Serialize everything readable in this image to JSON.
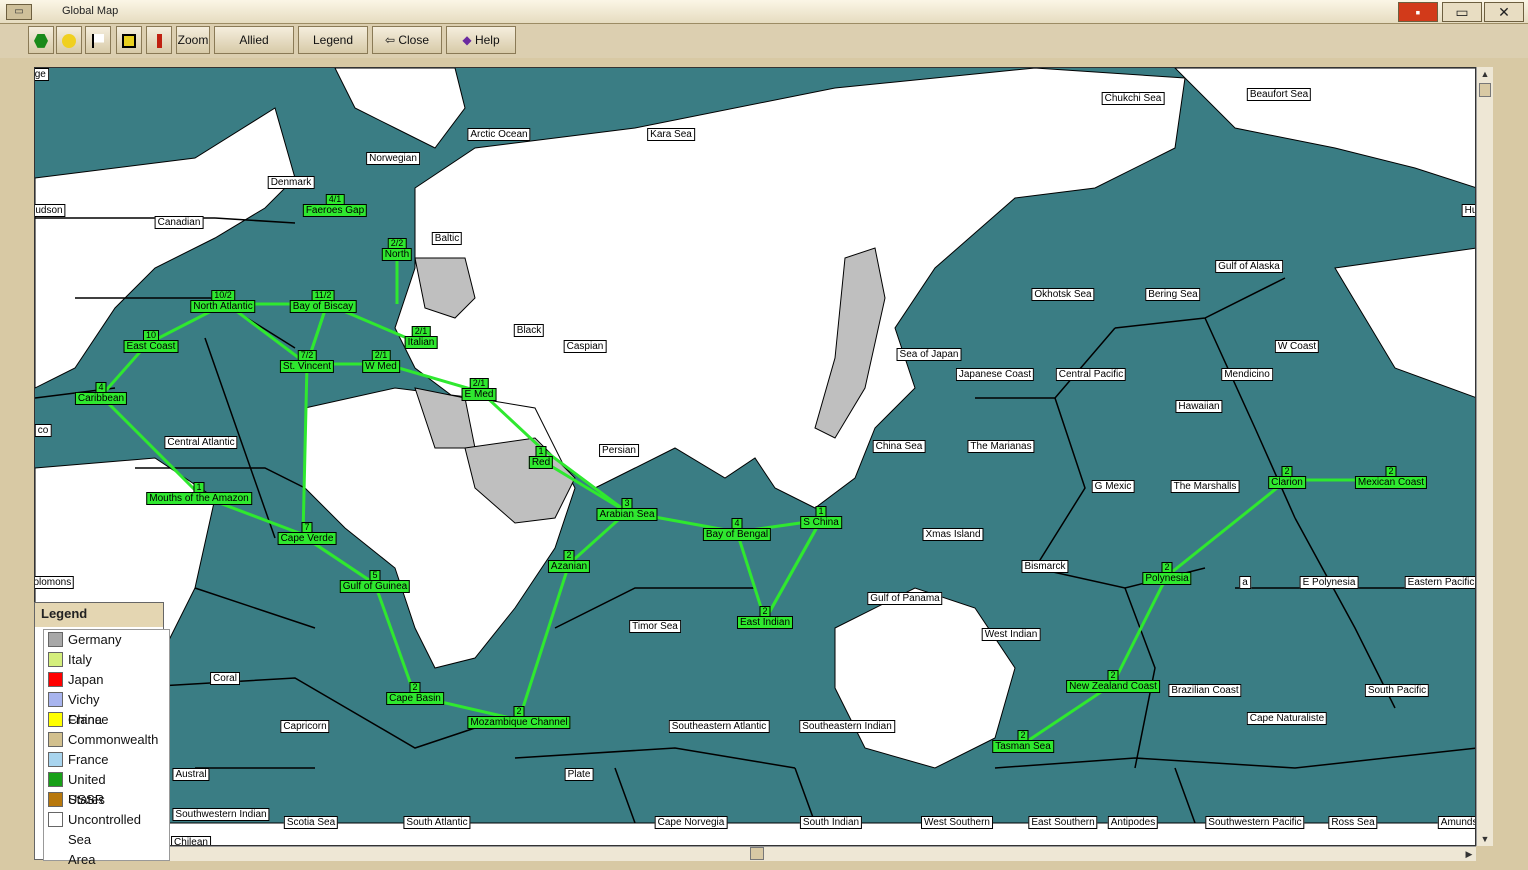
{
  "window": {
    "title": "Global Map",
    "icon": "map-window-icon"
  },
  "toolbar": {
    "icons": [
      "hexagon-icon",
      "sun-icon",
      "flag-icon",
      "grid-icon",
      "marker-icon"
    ],
    "zoom_label": "Zoom",
    "convoys_label": "Allied Convoys",
    "legend_label": "Legend",
    "close_label": "Close",
    "help_label": "Help"
  },
  "map": {
    "colors": {
      "sea": "#3a7d84",
      "land": "#ffffff",
      "convoy_route": "#2fe82f",
      "axis_land": "#bfbfbf"
    },
    "sea_areas": [
      "Chukchi Sea",
      "Beaufort Sea",
      "Arctic Ocean",
      "Kara Sea",
      "Norwegian",
      "Denmark",
      "udson",
      "Canadian",
      "Baltic",
      "Okhotsk Sea",
      "Bering Sea",
      "Gulf of Alaska",
      "Hu",
      "Black",
      "Caspian",
      "Sea of Japan",
      "Japanese Coast",
      "Central Pacific",
      "Mendicino",
      "W Coast",
      "co",
      "Central Atlantic",
      "Hawaiian",
      "Persian",
      "China Sea",
      "The Marianas",
      "G Mexic",
      "The Marshalls",
      "Xmas Island",
      "Bismarck",
      "The Solomons",
      "a",
      "E Polynesia",
      "Eastern Pacific",
      "Gulf of Panama",
      "Timor Sea",
      "West Indian",
      "Coral",
      "Brazilian Coast",
      "South Pacific",
      "Capricorn",
      "Southeastern Atlantic",
      "Southeastern Indian",
      "Cape Naturaliste",
      "Austral",
      "Plate",
      "Southwestern Indian",
      "Scotia Sea",
      "South Atlantic",
      "Cape Norvegia",
      "South Indian",
      "West Southern",
      "East Southern",
      "Antipodes",
      "Southwestern Pacific",
      "Ross Sea",
      "Amundsen Sea",
      "Chilean",
      "sage"
    ],
    "convoy_areas": [
      {
        "name": "Faeroes Gap",
        "count": "4/1"
      },
      {
        "name": "North",
        "count": "2/2"
      },
      {
        "name": "North Atlantic",
        "count": "10/2"
      },
      {
        "name": "Bay of Biscay",
        "count": "11/2"
      },
      {
        "name": "East Coast",
        "count": "10"
      },
      {
        "name": "Italian",
        "count": "2/1"
      },
      {
        "name": "St. Vincent",
        "count": "7/2"
      },
      {
        "name": "W Med",
        "count": "2/1"
      },
      {
        "name": "Caribbean",
        "count": "4"
      },
      {
        "name": "E Med",
        "count": "2/1"
      },
      {
        "name": "Red",
        "count": "1"
      },
      {
        "name": "Mouths of the Amazon",
        "count": "1"
      },
      {
        "name": "Arabian Sea",
        "count": "3"
      },
      {
        "name": "Bay of Bengal",
        "count": "4"
      },
      {
        "name": "S China",
        "count": "1"
      },
      {
        "name": "Cape Verde",
        "count": "7"
      },
      {
        "name": "Azanian",
        "count": "2"
      },
      {
        "name": "Gulf of Guinea",
        "count": "5"
      },
      {
        "name": "East Indian",
        "count": "2"
      },
      {
        "name": "Cape Basin",
        "count": "2"
      },
      {
        "name": "Mozambique Channel",
        "count": "2"
      },
      {
        "name": "Clarion",
        "count": "2"
      },
      {
        "name": "Mexican Coast",
        "count": "2"
      },
      {
        "name": "Polynesia",
        "count": "2"
      },
      {
        "name": "New Zealand Coast",
        "count": "2"
      },
      {
        "name": "Tasman Sea",
        "count": "2"
      }
    ]
  },
  "legend": {
    "title": "Legend",
    "items": [
      {
        "label": "Germany",
        "color": "#a8a8a8"
      },
      {
        "label": "Italy",
        "color": "#d4ee7c"
      },
      {
        "label": "Japan",
        "color": "#ff0000"
      },
      {
        "label": "Vichy France",
        "color": "#a8b4ee"
      },
      {
        "label": "China",
        "color": "#ffff00"
      },
      {
        "label": "Commonwealth",
        "color": "#d2c08e"
      },
      {
        "label": "France",
        "color": "#a8d4ee"
      },
      {
        "label": "United States",
        "color": "#18a018"
      },
      {
        "label": "USSR",
        "color": "#b8780c"
      },
      {
        "label": "Uncontrolled",
        "color": "#ffffff"
      },
      {
        "label": "Sea Area",
        "color": "#3a7d84"
      }
    ]
  }
}
